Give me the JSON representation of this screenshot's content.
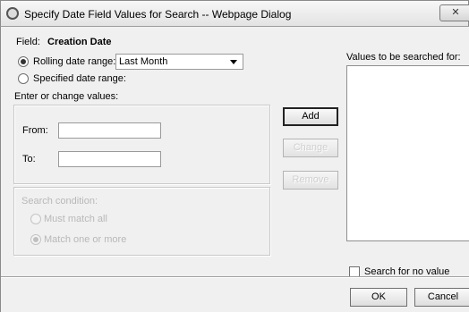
{
  "window": {
    "title": "Specify Date Field Values for Search -- Webpage Dialog",
    "close_glyph": "✕"
  },
  "field": {
    "caption": "Field:",
    "value": "Creation Date"
  },
  "range_options": {
    "rolling_label": "Rolling date range:",
    "rolling_selected": true,
    "rolling_value": "Last Month",
    "specified_label": "Specified date range:",
    "specified_selected": false
  },
  "values_section": {
    "label": "Enter or change values:",
    "from_label": "From:",
    "from_value": "",
    "to_label": "To:",
    "to_value": ""
  },
  "search_condition": {
    "label": "Search condition:",
    "options": [
      {
        "label": "Must match all",
        "selected": false
      },
      {
        "label": "Match one or more",
        "selected": true
      }
    ]
  },
  "buttons": {
    "add": "Add",
    "change": "Change",
    "remove": "Remove",
    "ok": "OK",
    "cancel": "Cancel"
  },
  "values_list": {
    "label": "Values to be searched for:",
    "items": []
  },
  "no_value": {
    "label": "Search for no value",
    "checked": false
  }
}
